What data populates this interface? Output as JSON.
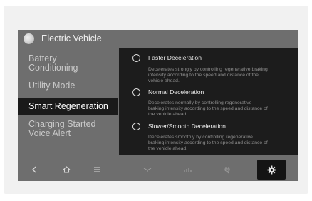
{
  "header": {
    "title": "Electric Vehicle",
    "logo_icon": "ev-logo-icon"
  },
  "menu": {
    "items": [
      {
        "lines": [
          "Battery",
          "Conditioning"
        ],
        "selected": false
      },
      {
        "lines": [
          "Utility Mode"
        ],
        "selected": false
      },
      {
        "lines": [
          "Smart Regeneration"
        ],
        "selected": true
      },
      {
        "lines": [
          "Charging Started",
          "Voice Alert"
        ],
        "selected": false
      }
    ]
  },
  "options": [
    {
      "title": "Faster Deceleration",
      "description": [
        "Decelerates strongly by controlling regenerative braking",
        "intensity according to the speed and distance of the",
        "vehicle ahead."
      ],
      "selected": false
    },
    {
      "title": "Normal Deceleration",
      "description": [
        "Decelerates normally by controlling regenerative",
        "braking intensity according to the speed and distance of",
        "the vehicle ahead."
      ],
      "selected": false
    },
    {
      "title": "Slower/Smooth Deceleration",
      "description": [
        "Decelerates smoothly by controlling regenerative",
        "braking intensity according to the speed and distance of",
        "the vehicle ahead."
      ],
      "selected": false
    }
  ],
  "bottom_bar": {
    "buttons": [
      {
        "name": "back",
        "icon": "back-chevron-icon"
      },
      {
        "name": "home",
        "icon": "home-icon"
      },
      {
        "name": "menu",
        "icon": "list-menu-icon"
      },
      {
        "name": "drive-mode",
        "icon": "drive-mode-icon"
      },
      {
        "name": "energy-info",
        "icon": "energy-chart-icon"
      },
      {
        "name": "charging",
        "icon": "charging-plug-icon"
      },
      {
        "name": "settings",
        "icon": "gear-icon",
        "active": true
      }
    ]
  },
  "colors": {
    "screen_background": "#6e6e6e",
    "panel_background": "#1c1c1c",
    "selected_item_background": "#1a1a1a",
    "text_primary": "#ececec",
    "text_secondary": "#8e8e8e"
  }
}
